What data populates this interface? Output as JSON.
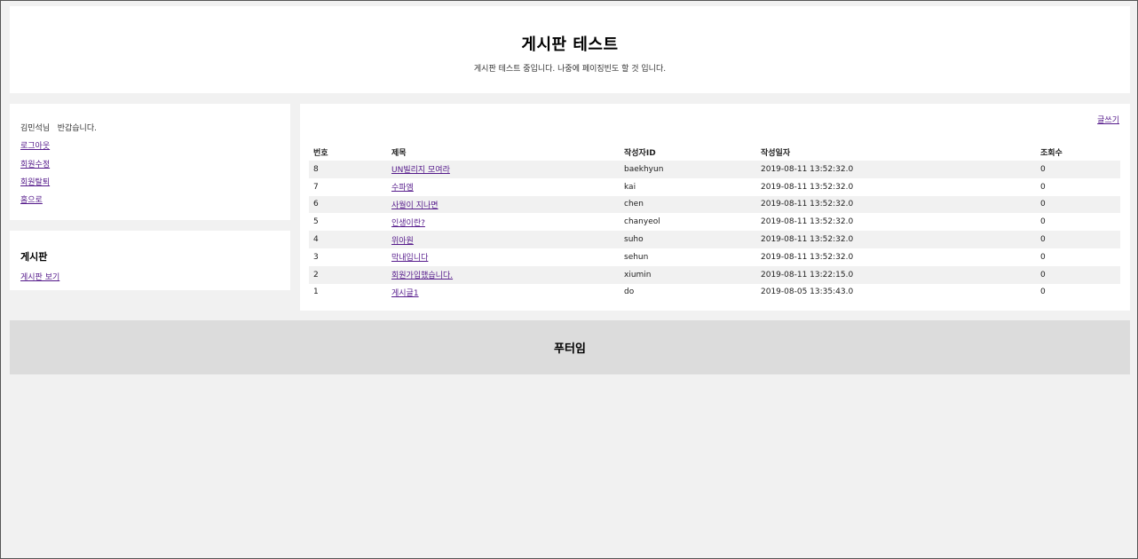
{
  "header": {
    "title": "게시판 테스트",
    "subtitle": "게시판 테스트 중입니다. 나중에 페이징빈도 할 것 입니다."
  },
  "sidebar": {
    "greeting": "김민석님   반갑습니다.",
    "links": [
      "로그아웃",
      "회원수정",
      "회원탈퇴",
      "홈으로"
    ],
    "board_title": "게시판",
    "board_link": "게시판 보기"
  },
  "main": {
    "write_label": "글쓰기",
    "columns": [
      "번호",
      "제목",
      "작성자ID",
      "작성일자",
      "조회수"
    ],
    "rows": [
      {
        "num": "8",
        "title": "UN빌리지 모여라",
        "author": "baekhyun",
        "date": "2019-08-11 13:52:32.0",
        "views": "0"
      },
      {
        "num": "7",
        "title": "수파엠",
        "author": "kai",
        "date": "2019-08-11 13:52:32.0",
        "views": "0"
      },
      {
        "num": "6",
        "title": "사월이 지나면",
        "author": "chen",
        "date": "2019-08-11 13:52:32.0",
        "views": "0"
      },
      {
        "num": "5",
        "title": "인생이란?",
        "author": "chanyeol",
        "date": "2019-08-11 13:52:32.0",
        "views": "0"
      },
      {
        "num": "4",
        "title": "위아원",
        "author": "suho",
        "date": "2019-08-11 13:52:32.0",
        "views": "0"
      },
      {
        "num": "3",
        "title": "막내입니다",
        "author": "sehun",
        "date": "2019-08-11 13:52:32.0",
        "views": "0"
      },
      {
        "num": "2",
        "title": "회원가입했습니다.",
        "author": "xiumin",
        "date": "2019-08-11 13:22:15.0",
        "views": "0"
      },
      {
        "num": "1",
        "title": "게시글1",
        "author": "do",
        "date": "2019-08-05 13:35:43.0",
        "views": "0"
      }
    ]
  },
  "footer": {
    "text": "푸터임"
  },
  "colors": {
    "link": "#551a8b",
    "page_bg": "#f1f1f1",
    "footer_bg": "#dcdcdc"
  }
}
